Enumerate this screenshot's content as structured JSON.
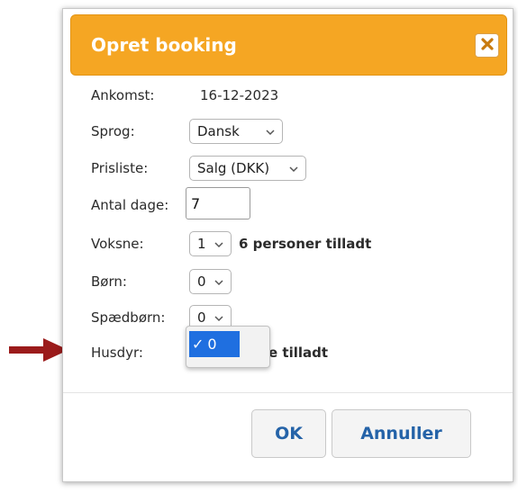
{
  "dialog": {
    "title": "Opret booking",
    "close_icon": "close-x-icon",
    "accent_color": "#f5a623"
  },
  "form": {
    "ankomst": {
      "label": "Ankomst:",
      "value": "16-12-2023"
    },
    "sprog": {
      "label": "Sprog:",
      "value": "Dansk"
    },
    "prisliste": {
      "label": "Prisliste:",
      "value": "Salg (DKK)"
    },
    "antal_dage": {
      "label": "Antal dage:",
      "value": "7"
    },
    "voksne": {
      "label": "Voksne:",
      "value": "1",
      "note": "6 personer tilladt"
    },
    "born": {
      "label": "Børn:",
      "value": "0"
    },
    "spaedborn": {
      "label": "Spædbørn:",
      "value": "0"
    },
    "husdyr": {
      "label": "Husdyr:",
      "note_visible": "e tilladt"
    }
  },
  "dropdown": {
    "options": [
      {
        "label": "0",
        "checked": true,
        "check_glyph": "✓"
      }
    ],
    "highlight_color": "#1f6fe0"
  },
  "buttons": {
    "ok": "OK",
    "cancel": "Annuller",
    "label_color": "#2563a8"
  },
  "annotation": {
    "arrow_icon": "red-arrow-icon",
    "color": "#9b1b1b"
  }
}
